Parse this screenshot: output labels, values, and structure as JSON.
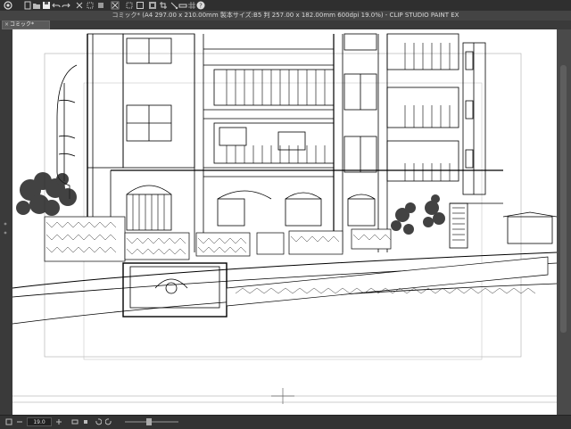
{
  "app": {
    "title": "コミック* (A4 297.00 x 210.00mm 製本サイズ:B5 判 257.00 x 182.00mm 600dpi 19.0%) - CLIP STUDIO PAINT EX"
  },
  "tabs": [
    {
      "label": "コミック*",
      "close": "×"
    }
  ],
  "toolbar": {
    "icons": [
      "clip-studio-logo-icon",
      "new-file-icon",
      "open-file-icon",
      "save-icon",
      "undo-icon",
      "redo-icon",
      "clear-icon",
      "transform-icon",
      "fill-icon",
      "selection-icon",
      "select-all-icon",
      "deselect-icon",
      "invert-selection-icon",
      "crop-icon",
      "snap-icon",
      "ruler-icon",
      "grid-icon",
      "help-icon"
    ]
  },
  "status": {
    "zoom": "19.0"
  },
  "colors": {
    "chrome": "#3c3c3c",
    "titlebar": "#444444",
    "paper": "#ffffff",
    "linework": "#000000"
  }
}
